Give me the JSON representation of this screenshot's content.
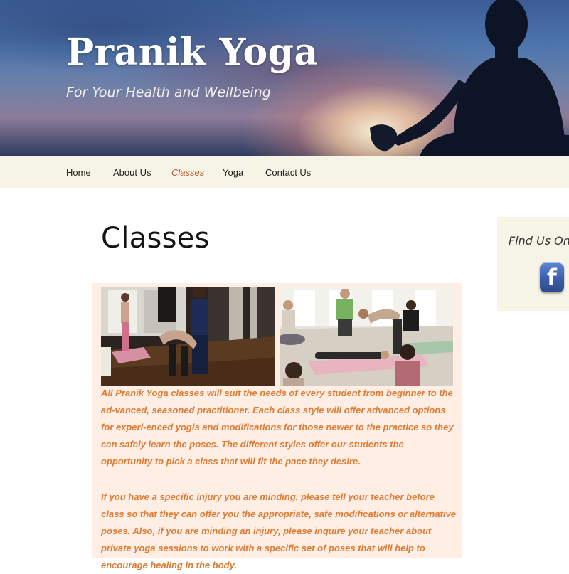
{
  "header": {
    "site_title": "Pranik Yoga",
    "tagline": "For Your Health and Wellbeing"
  },
  "nav": {
    "items": [
      {
        "label": "Home",
        "active": false
      },
      {
        "label": "About Us",
        "active": false
      },
      {
        "label": "Classes",
        "active": true
      },
      {
        "label": "Yoga",
        "active": false
      },
      {
        "label": "Contact Us",
        "active": false
      }
    ]
  },
  "sidebar": {
    "widget_title": "Find Us On",
    "social_icon": "facebook-icon",
    "social_glyph": "f"
  },
  "main": {
    "page_title": "Classes",
    "paragraphs": [
      "All Pranik Yoga classes will suit the needs of every student from beginner to the ad-vanced, seasoned practitioner. Each class style will offer advanced options for experi-enced yogis and modifications for those newer to the practice so they can safely learn the poses. The different styles offer our students the opportunity to pick a class that will fit the pace they desire.",
      "If you have a specific injury you are minding, please tell your teacher before class so that they can offer you the appropriate, safe modifications or alternative poses. Also, if you are minding an injury, please inquire your teacher about private yoga sessions to work with a specific set of poses that will help to encourage healing in the body."
    ]
  },
  "colors": {
    "nav_background": "#f6f4e6",
    "active_nav": "#b95a2c",
    "content_background": "#ffeee4",
    "body_text": "#e07b34",
    "facebook_blue": "#3b5ea8"
  }
}
